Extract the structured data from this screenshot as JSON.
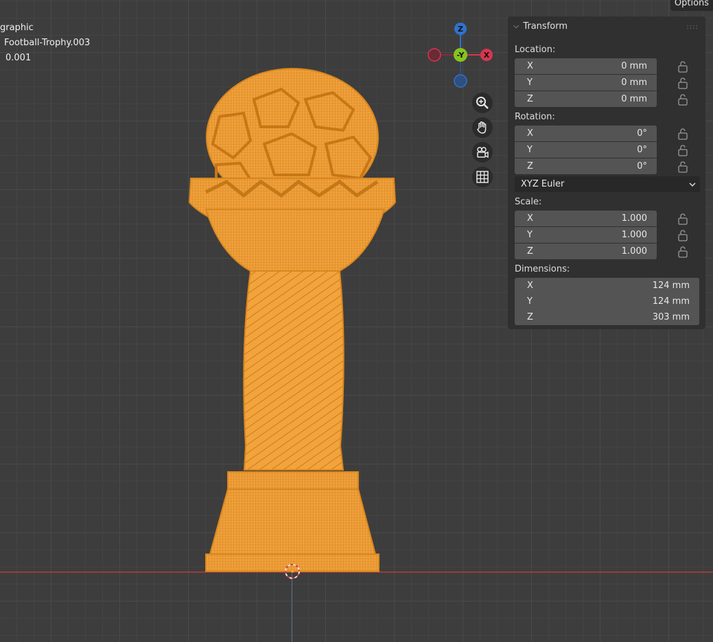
{
  "viewport": {
    "overlay": {
      "view_name": "graphic",
      "object_name": "Football-Trophy.003",
      "scale_text": "0.001"
    },
    "options_label": "Options",
    "gizmo": {
      "z": "Z",
      "y": "-Y",
      "x": "X"
    },
    "nav_icons": [
      "zoom-icon",
      "hand-pan-icon",
      "camera-icon",
      "grid-icon"
    ]
  },
  "transform_panel": {
    "title": "Transform",
    "location": {
      "label": "Location:",
      "fields": [
        {
          "axis": "X",
          "value": "0 mm"
        },
        {
          "axis": "Y",
          "value": "0 mm"
        },
        {
          "axis": "Z",
          "value": "0 mm"
        }
      ]
    },
    "rotation": {
      "label": "Rotation:",
      "fields": [
        {
          "axis": "X",
          "value": "0°"
        },
        {
          "axis": "Y",
          "value": "0°"
        },
        {
          "axis": "Z",
          "value": "0°"
        }
      ],
      "mode": "XYZ Euler"
    },
    "scale": {
      "label": "Scale:",
      "fields": [
        {
          "axis": "X",
          "value": "1.000"
        },
        {
          "axis": "Y",
          "value": "1.000"
        },
        {
          "axis": "Z",
          "value": "1.000"
        }
      ]
    },
    "dimensions": {
      "label": "Dimensions:",
      "fields": [
        {
          "axis": "X",
          "value": "124 mm"
        },
        {
          "axis": "Y",
          "value": "124 mm"
        },
        {
          "axis": "Z",
          "value": "303 mm"
        }
      ]
    }
  },
  "colors": {
    "selection_orange": "#f5a23a",
    "axis_x": "#d8364e",
    "axis_y": "#86c41e",
    "axis_z": "#2f72cc"
  }
}
